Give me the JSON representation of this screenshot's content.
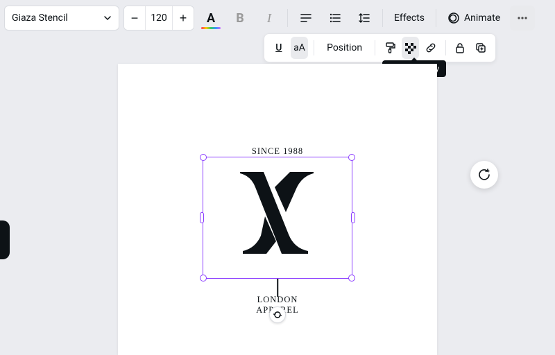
{
  "toolbar": {
    "font_name": "Giaza Stencil",
    "font_size": "120",
    "minus": "−",
    "plus": "+",
    "effects_label": "Effects",
    "animate_label": "Animate",
    "more": "•••"
  },
  "sub_toolbar": {
    "underline": "U",
    "case": "aA",
    "position_label": "Position"
  },
  "tooltip_text": "Transparency",
  "design": {
    "since": "SINCE 1988",
    "london": "LONDON",
    "apparel": "APPAREL"
  }
}
